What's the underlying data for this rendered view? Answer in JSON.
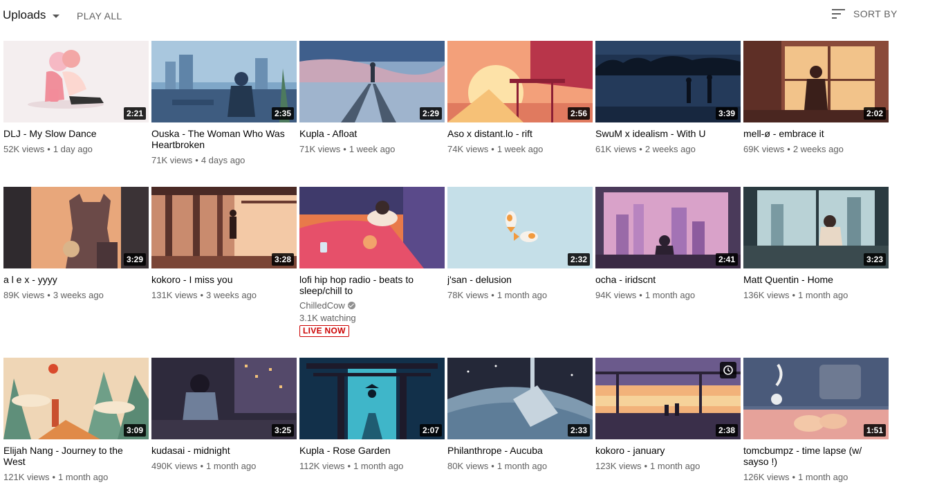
{
  "header": {
    "uploads_label": "Uploads",
    "play_all_label": "PLAY ALL",
    "sort_label": "SORT BY"
  },
  "videos": [
    {
      "title": "DLJ - My Slow Dance",
      "views": "52K views",
      "age": "1 day ago",
      "duration": "2:21",
      "icon": "thumb-girl-hugging"
    },
    {
      "title": "Ouska - The Woman Who Was Heartbroken",
      "views": "71K views",
      "age": "4 days ago",
      "duration": "2:35",
      "icon": "thumb-city-window"
    },
    {
      "title": "Kupla - Afloat",
      "views": "71K views",
      "age": "1 week ago",
      "duration": "2:29",
      "icon": "thumb-rail-sunset"
    },
    {
      "title": "Aso x distant.lo - rift",
      "views": "74K views",
      "age": "1 week ago",
      "duration": "2:56",
      "icon": "thumb-red-balcony"
    },
    {
      "title": "SwuM x idealism - With U",
      "views": "61K views",
      "age": "2 weeks ago",
      "duration": "3:39",
      "icon": "thumb-night-couple"
    },
    {
      "title": "mell-ø - embrace it",
      "views": "69K views",
      "age": "2 weeks ago",
      "duration": "2:02",
      "icon": "thumb-window-girl"
    },
    {
      "title": "a l e x - yyyy",
      "views": "89K views",
      "age": "3 weeks ago",
      "duration": "3:29",
      "icon": "thumb-shadow-room"
    },
    {
      "title": "kokoro - I miss you",
      "views": "131K views",
      "age": "3 weeks ago",
      "duration": "3:28",
      "icon": "thumb-station"
    },
    {
      "title": "lofi hip hop radio - beats to sleep/chill to",
      "channel": "ChilledCow",
      "watching": "3.1K watching",
      "live": "LIVE NOW",
      "icon": "thumb-sleeping-girl"
    },
    {
      "title": "j'san - delusion",
      "views": "78K views",
      "age": "1 month ago",
      "duration": "2:32",
      "icon": "thumb-koi-fish"
    },
    {
      "title": "ocha - iridscnt",
      "views": "94K views",
      "age": "1 month ago",
      "duration": "2:41",
      "icon": "thumb-pink-city"
    },
    {
      "title": "Matt Quentin - Home",
      "views": "136K views",
      "age": "1 month ago",
      "duration": "3:23",
      "icon": "thumb-city-room"
    },
    {
      "title": "Elijah Nang - Journey to the West",
      "views": "121K views",
      "age": "1 month ago",
      "duration": "3:09",
      "icon": "thumb-mountains"
    },
    {
      "title": "kudasai - midnight",
      "views": "490K views",
      "age": "1 month ago",
      "duration": "3:25",
      "icon": "thumb-night-city-girl"
    },
    {
      "title": "Kupla - Rose Garden",
      "views": "112K views",
      "age": "1 month ago",
      "duration": "2:07",
      "icon": "thumb-torii-gate"
    },
    {
      "title": "Philanthrope - Aucuba",
      "views": "80K views",
      "age": "1 month ago",
      "duration": "2:33",
      "icon": "thumb-space-planet"
    },
    {
      "title": "kokoro - january",
      "views": "123K views",
      "age": "1 month ago",
      "duration": "2:38",
      "icon": "thumb-sunset-station",
      "watch_later": "clock-icon"
    },
    {
      "title": "tomcbumpz - time lapse (w/ sayso !)",
      "views": "126K views",
      "age": "1 month ago",
      "duration": "1:51",
      "icon": "thumb-feet-table"
    }
  ]
}
